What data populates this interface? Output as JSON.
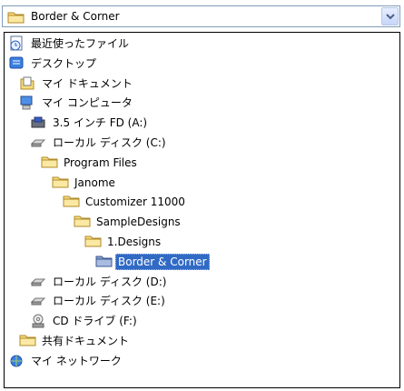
{
  "dropdown": {
    "selected": "Border & Corner",
    "icon": "folder-icon"
  },
  "tree": [
    {
      "label": "最近使ったファイル",
      "icon": "recent-documents-icon"
    },
    {
      "label": "デスクトップ",
      "icon": "desktop-icon"
    },
    {
      "label": "マイ ドキュメント",
      "icon": "my-documents-icon"
    },
    {
      "label": "マイ コンピュータ",
      "icon": "my-computer-icon"
    },
    {
      "label": "3.5 インチ FD (A:)",
      "icon": "floppy-drive-icon"
    },
    {
      "label": "ローカル ディスク (C:)",
      "icon": "hard-disk-icon"
    },
    {
      "label": "Program Files",
      "icon": "folder-icon"
    },
    {
      "label": "Janome",
      "icon": "folder-icon"
    },
    {
      "label": "Customizer 11000",
      "icon": "folder-icon"
    },
    {
      "label": "SampleDesigns",
      "icon": "folder-icon"
    },
    {
      "label": "1.Designs",
      "icon": "folder-icon"
    },
    {
      "label": "Border & Corner",
      "icon": "folder-icon",
      "selected": true
    },
    {
      "label": "ローカル ディスク (D:)",
      "icon": "hard-disk-icon"
    },
    {
      "label": "ローカル ディスク (E:)",
      "icon": "hard-disk-icon"
    },
    {
      "label": "CD ドライブ (F:)",
      "icon": "cd-drive-icon"
    },
    {
      "label": "共有ドキュメント",
      "icon": "folder-icon"
    },
    {
      "label": "マイ ネットワーク",
      "icon": "my-network-icon"
    }
  ],
  "colors": {
    "selection": "#316ac5",
    "folder": "#f5d76e",
    "border": "#7f9db9"
  }
}
